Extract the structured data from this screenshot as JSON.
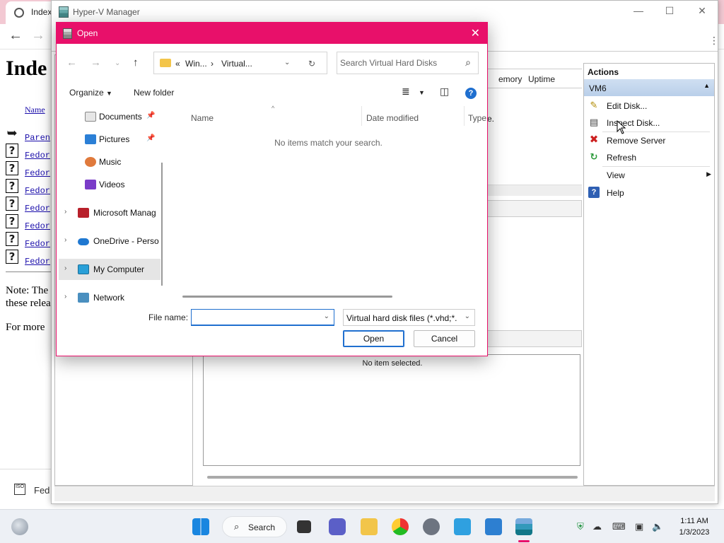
{
  "browser": {
    "tab_title": "Index",
    "page_heading": "Inde",
    "col_name": "Name",
    "rows": [
      "Paren",
      "Fedor",
      "Fedor",
      "Fedor",
      "Fedor",
      "Fedor",
      "Fedor",
      "Fedor"
    ],
    "note_line1": "Note: The",
    "note_line2": "these relea",
    "more_text": "For more",
    "download_label": "Fed"
  },
  "hyperv": {
    "title": "Hyper-V Manager",
    "columns": {
      "memory": "emory",
      "uptime": "Uptime"
    },
    "column_fragment": "e.",
    "details_empty": "No item selected.",
    "actions": {
      "header": "Actions",
      "group": "VM6",
      "items": [
        {
          "label": "Edit Disk...",
          "icon": "edit-disk-icon"
        },
        {
          "label": "Inspect Disk...",
          "icon": "inspect-disk-icon"
        },
        {
          "label": "Remove Server",
          "icon": "remove-x-icon"
        },
        {
          "label": "Refresh",
          "icon": "refresh-icon"
        },
        {
          "label": "View",
          "icon": ""
        },
        {
          "label": "Help",
          "icon": "help-icon"
        }
      ]
    }
  },
  "dialog": {
    "title": "Open",
    "address": {
      "prefix": "«",
      "crumb1": "Win...",
      "crumb2": "Virtual..."
    },
    "search_placeholder": "Search Virtual Hard Disks",
    "toolbar": {
      "organize": "Organize",
      "new_folder": "New folder"
    },
    "nav_items": [
      {
        "label": "Documents",
        "pinned": true
      },
      {
        "label": "Pictures",
        "pinned": true
      },
      {
        "label": "Music",
        "pinned": false
      },
      {
        "label": "Videos",
        "pinned": false
      },
      {
        "label": "Microsoft Manag",
        "pinned": false
      },
      {
        "label": "OneDrive - Perso",
        "pinned": false
      },
      {
        "label": "My Computer",
        "pinned": false
      },
      {
        "label": "Network",
        "pinned": false
      }
    ],
    "columns": {
      "name": "Name",
      "date": "Date modified",
      "type": "Type"
    },
    "empty_message": "No items match your search.",
    "filename_label": "File name:",
    "filename_value": "",
    "filetype": "Virtual hard disk files   (*.vhd;*.",
    "open_button": "Open",
    "cancel_button": "Cancel"
  },
  "taskbar": {
    "search_label": "Search",
    "time": "1:11 AM",
    "date": "1/3/2023"
  },
  "colors": {
    "accent": "#e8106a",
    "selection_blue": "#1f6fcf",
    "browser_tab_bar": "#f3c9d3"
  }
}
